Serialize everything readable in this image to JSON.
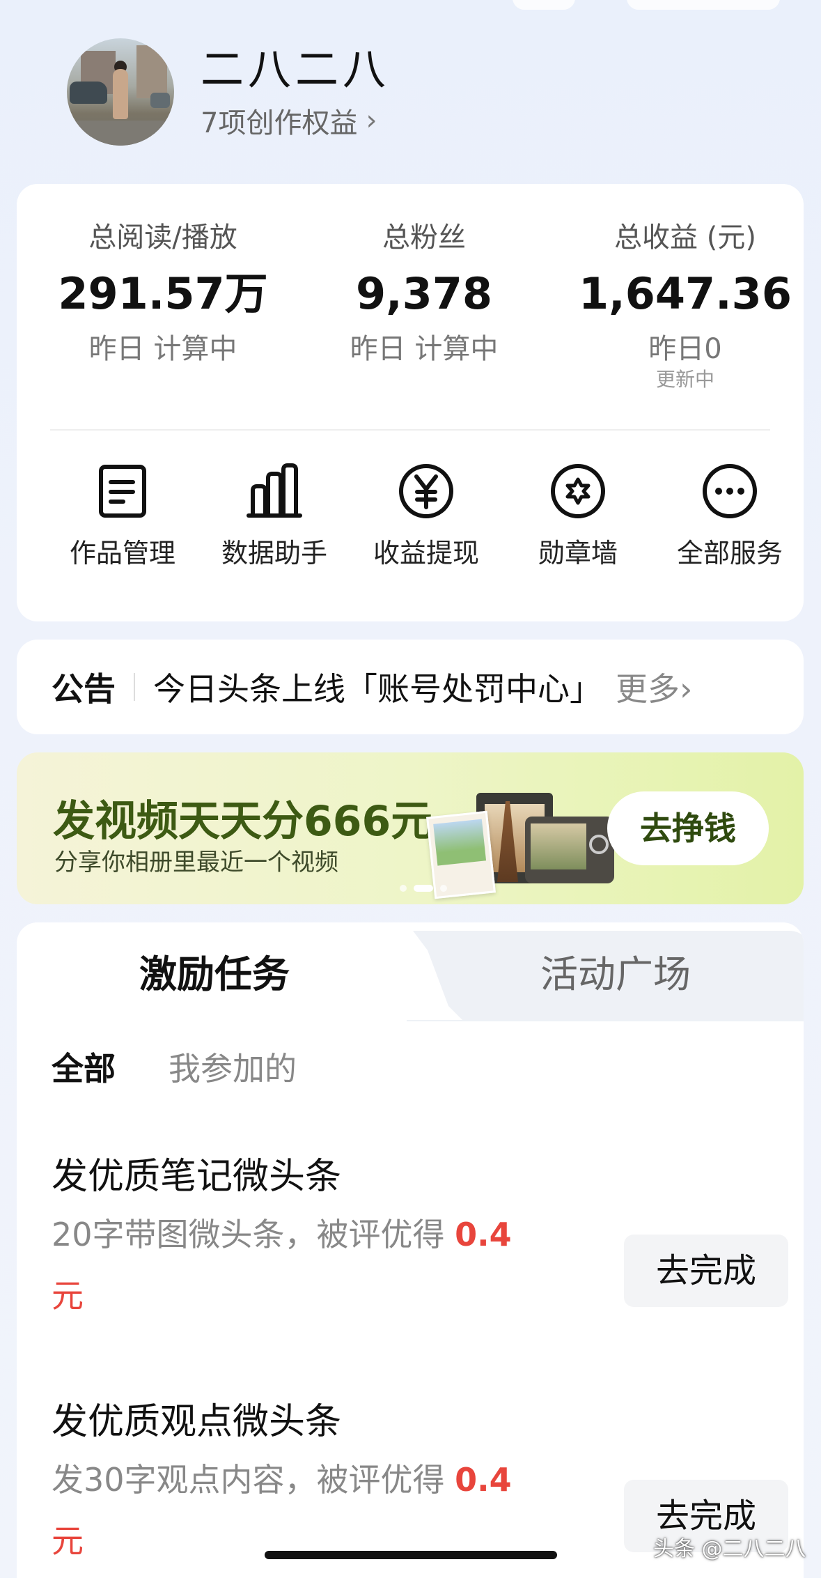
{
  "profile": {
    "name": "二八二八",
    "rights": "7项创作权益"
  },
  "stats": [
    {
      "label": "总阅读/播放",
      "value": "291.57万",
      "sub": "昨日 计算中",
      "sub2": ""
    },
    {
      "label": "总粉丝",
      "value": "9,378",
      "sub": "昨日 计算中",
      "sub2": ""
    },
    {
      "label": "总收益 (元)",
      "value": "1,647.36",
      "sub": "昨日0",
      "sub2": "更新中"
    }
  ],
  "services": [
    {
      "label": "作品管理",
      "icon": "document-icon"
    },
    {
      "label": "数据助手",
      "icon": "bar-chart-icon"
    },
    {
      "label": "收益提现",
      "icon": "yuan-icon"
    },
    {
      "label": "勋章墙",
      "icon": "medal-icon"
    },
    {
      "label": "全部服务",
      "icon": "more-icon"
    }
  ],
  "notice": {
    "tag": "公告",
    "text": "今日头条上线「账号处罚中心」",
    "more": "更多"
  },
  "banner": {
    "title": "发视频天天分666元",
    "subtitle": "分享你相册里最近一个视频",
    "button": "去挣钱"
  },
  "tabs": {
    "active": "激励任务",
    "inactive": "活动广场"
  },
  "filters": {
    "all": "全部",
    "joined": "我参加的"
  },
  "tasks": [
    {
      "title": "发优质笔记微头条",
      "desc": "20字带图微头条，被评优得",
      "reward": "0.4",
      "unit": "元",
      "button": "去完成"
    },
    {
      "title": "发优质观点微头条",
      "desc": "发30字观点内容，被评优得",
      "reward": "0.4",
      "unit": "元",
      "button": "去完成"
    }
  ],
  "watermark": "头条 @二八二八",
  "colors": {
    "accent_red": "#e8453c",
    "banner_green": "#3d5a13",
    "background": "#eef2fb"
  }
}
